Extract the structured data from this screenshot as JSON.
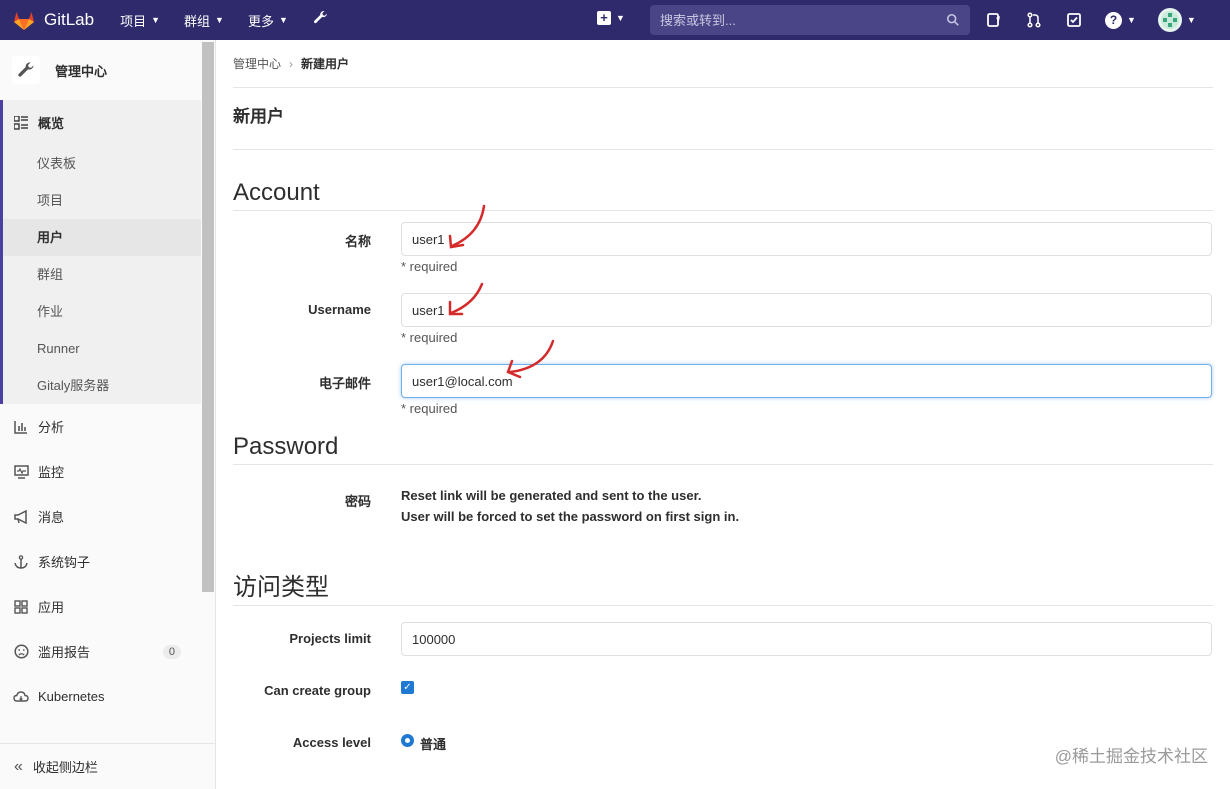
{
  "navbar": {
    "brand": "GitLab",
    "menu": [
      {
        "label": "项目"
      },
      {
        "label": "群组"
      },
      {
        "label": "更多"
      }
    ],
    "search_placeholder": "搜索或转到..."
  },
  "sidebar": {
    "title": "管理中心",
    "overview": {
      "label": "概览",
      "items": [
        "仪表板",
        "项目",
        "用户",
        "群组",
        "作业",
        "Runner",
        "Gitaly服务器"
      ]
    },
    "items": [
      {
        "label": "分析",
        "icon": "chart-icon"
      },
      {
        "label": "监控",
        "icon": "monitor-icon"
      },
      {
        "label": "消息",
        "icon": "megaphone-icon"
      },
      {
        "label": "系统钩子",
        "icon": "hook-icon"
      },
      {
        "label": "应用",
        "icon": "grid-icon"
      },
      {
        "label": "滥用报告",
        "icon": "frown-icon",
        "badge": "0"
      },
      {
        "label": "Kubernetes",
        "icon": "cloud-icon"
      }
    ],
    "collapse_label": "收起侧边栏"
  },
  "breadcrumb": {
    "parent": "管理中心",
    "current": "新建用户"
  },
  "page_title": "新用户",
  "account": {
    "title": "Account",
    "name_label": "名称",
    "name_value": "user1",
    "username_label": "Username",
    "username_value": "user1",
    "email_label": "电子邮件",
    "email_value": "user1@local.com",
    "required": "* required"
  },
  "password": {
    "title": "Password",
    "label": "密码",
    "line1": "Reset link will be generated and sent to the user.",
    "line2": "User will be forced to set the password on first sign in."
  },
  "access": {
    "title": "访问类型",
    "projects_limit_label": "Projects limit",
    "projects_limit_value": "100000",
    "can_create_group_label": "Can create group",
    "can_create_group_checked": true,
    "access_level_label": "Access level",
    "access_level_value": "普通"
  },
  "watermark": "@稀土掘金技术社区",
  "colors": {
    "navbar": "#2f2a6b",
    "accent": "#1f78d1",
    "annotation": "#d42a2a"
  }
}
